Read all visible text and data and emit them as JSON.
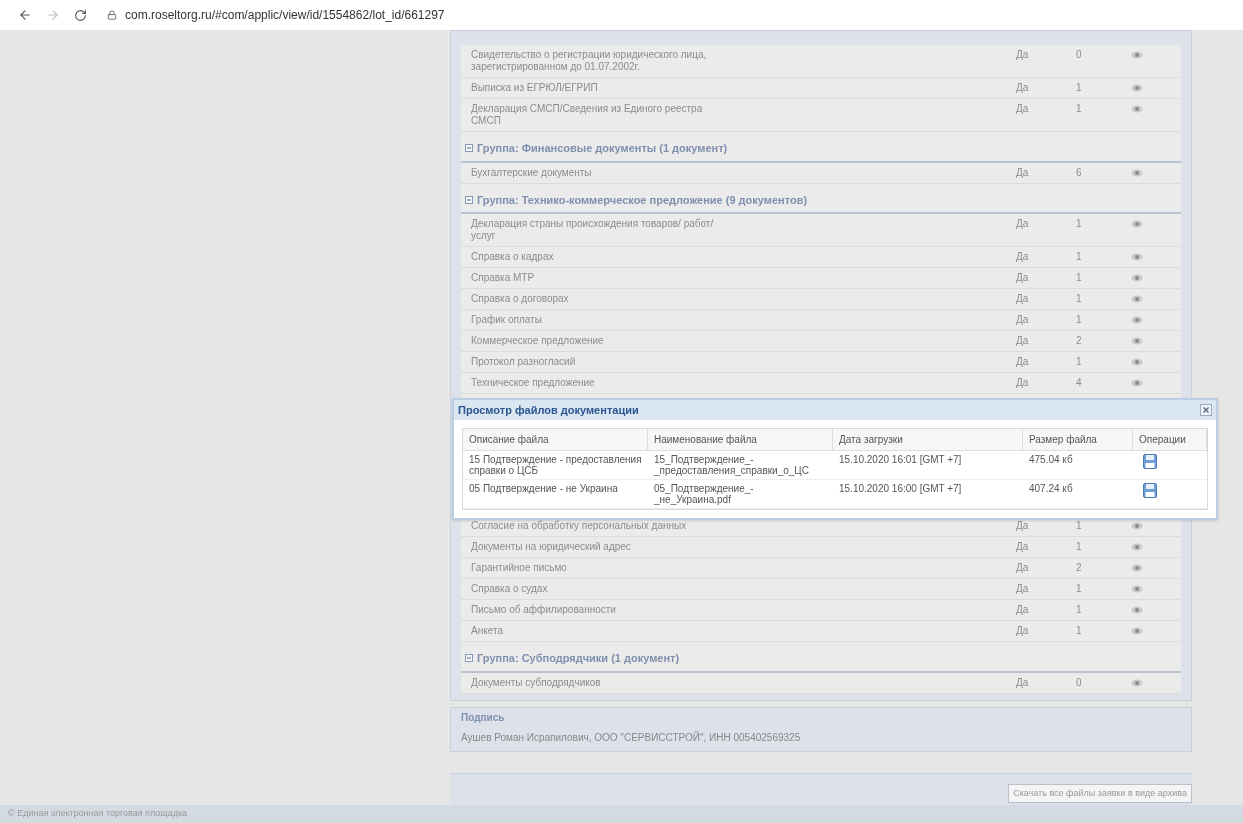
{
  "browser": {
    "url": "com.roseltorg.ru/#com/applic/view/id/1554862/lot_id/661297"
  },
  "groups": [
    {
      "rows": [
        {
          "name": "Свидетельство о регистрации юридического лица, зарегистрированном до 01.07.2002г.",
          "value": "Да",
          "count": "0"
        },
        {
          "name": "Выписка из ЕГРЮЛ/ЕГРИП",
          "value": "Да",
          "count": "1"
        },
        {
          "name": "Декларация СМСП/Сведения из Единого реестра СМСП",
          "value": "Да",
          "count": "1"
        }
      ]
    },
    {
      "title": "Группа: Финансовые документы (1 документ)",
      "rows": [
        {
          "name": "Бухгалтерские документы",
          "value": "Да",
          "count": "6"
        }
      ]
    },
    {
      "title": "Группа: Технико-коммерческое предложение (9 документов)",
      "rows": [
        {
          "name": "Декларация страны происхождения товаров/ работ/услуг",
          "value": "Да",
          "count": "1"
        },
        {
          "name": "Справка о кадрах",
          "value": "Да",
          "count": "1"
        },
        {
          "name": "Справка МТР",
          "value": "Да",
          "count": "1"
        },
        {
          "name": "Справка о договорах",
          "value": "Да",
          "count": "1"
        },
        {
          "name": "График оплаты",
          "value": "Да",
          "count": "1"
        },
        {
          "name": "Коммерческое предложение",
          "value": "Да",
          "count": "2"
        },
        {
          "name": "Протокол разногласий",
          "value": "Да",
          "count": "1"
        },
        {
          "name": "Техническое предложение",
          "value": "Да",
          "count": "4"
        }
      ]
    },
    {
      "rows": [
        {
          "name": "Согласие на обработку персональных данных",
          "value": "Да",
          "count": "1"
        },
        {
          "name": "Документы на юридический адрес",
          "value": "Да",
          "count": "1"
        },
        {
          "name": "Гарантийное письмо",
          "value": "Да",
          "count": "2"
        },
        {
          "name": "Справка о судах",
          "value": "Да",
          "count": "1"
        },
        {
          "name": "Письмо об аффилированности",
          "value": "Да",
          "count": "1"
        },
        {
          "name": "Анкета",
          "value": "Да",
          "count": "1"
        }
      ]
    },
    {
      "title": "Группа: Субподрядчики (1 документ)",
      "rows": [
        {
          "name": "Документы субподрядчиков",
          "value": "Да",
          "count": "0"
        }
      ]
    }
  ],
  "signature": {
    "legend": "Подпись",
    "text": "Аушев Роман Исрапилович, ООО \"СЕРВИССТРОЙ\", ИНН 005402569325"
  },
  "download_button": "Скачать все файлы заявки в виде архива",
  "footer": "© Единая электронная торговая площадка",
  "dialog": {
    "title": "Просмотр файлов документации",
    "columns": [
      "Описание файла",
      "Наименование файла",
      "Дата загрузки",
      "Размер файла",
      "Операции"
    ],
    "rows": [
      {
        "description": "15 Подтверждение - предоставления справки о ЦСБ",
        "file_name": "15_Подтверждение_- _предоставления_справки_о_ЦС",
        "date": "15.10.2020 16:01 [GMT +7]",
        "size": "475.04 кб"
      },
      {
        "description": "05 Подтверждение - не Украина",
        "file_name": "05_Подтверждение_- _не_Украина.pdf",
        "date": "15.10.2020 16:00 [GMT +7]",
        "size": "407.24 кб"
      }
    ]
  }
}
